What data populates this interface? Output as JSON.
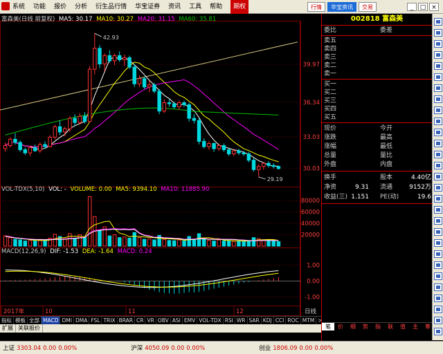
{
  "menu": {
    "items": [
      "系统",
      "功能",
      "报价",
      "分析",
      "衍生品行情",
      "华宝证券",
      "资讯",
      "工具",
      "帮助",
      "期权"
    ],
    "active_index": 9
  },
  "top_tabs": {
    "items": [
      "行情",
      "华宝资讯",
      "交易"
    ],
    "active_index": 1
  },
  "window_buttons": [
    "_",
    "□",
    "×"
  ],
  "chart": {
    "header_title": "富森美(日线 前复权)",
    "ma5": "MA5: 30.17",
    "ma10": "MA10: 30.27",
    "ma20": "MA20: 31.15",
    "ma60": "MA60: 35.81",
    "high_label": "42.93",
    "low_label": "29.19",
    "price_ticks": [
      "39.97",
      "36.34",
      "33.03",
      "30.03"
    ],
    "vol_header": {
      "title": "VOL-TDX(5,10)",
      "vol": "VOL: -",
      "volume": "VOLUME: 0.00",
      "ma5": "MA5: 9394.10",
      "ma10": "MA10: 11885.90"
    },
    "vol_ticks": [
      "80000",
      "60000",
      "40000",
      "20000"
    ],
    "macd_header": {
      "title": "MACD(12,26,9)",
      "dif": "DIF: -1.53",
      "dea": "DEA: -1.64",
      "macd": "MACD: 0.24"
    },
    "macd_ticks": [
      "1.00",
      "0.00",
      "-1.00"
    ],
    "date_labels": [
      "2017年",
      "10",
      "11",
      "12"
    ],
    "period_label": "日线",
    "colors": {
      "up": "#ff3232",
      "down": "#00d8e0",
      "ma5": "#ffffff",
      "ma10": "#ffff00",
      "ma20": "#ff00ff",
      "ma60": "#00c000",
      "grid": "#7a0000"
    }
  },
  "indicator_tabs": {
    "items": [
      "指标",
      "模板",
      "全部",
      "MACD",
      "DMI",
      "DMA",
      "FSL",
      "TRIX",
      "BRAR",
      "CR",
      "VR",
      "OBV",
      "ASI",
      "EMV",
      "VOL-TDX",
      "RSI",
      "WR",
      "SAR",
      "KDJ",
      "CCI",
      "ROC",
      "MTM",
      ">",
      "+",
      "-"
    ],
    "active_index": 3
  },
  "sub_tabs": [
    "扩展",
    "关联报价"
  ],
  "quote": {
    "code_name": "002818 富森美",
    "weibi_label": "委比",
    "weicha_label": "委差",
    "sell_levels": [
      "卖五",
      "卖四",
      "卖三",
      "卖二",
      "卖一"
    ],
    "buy_levels": [
      "买一",
      "买二",
      "买三",
      "买四",
      "买五"
    ],
    "stats_left": [
      "现价",
      "涨跌",
      "涨幅",
      "总量",
      "外盘"
    ],
    "stats_right": [
      "今开",
      "最高",
      "最低",
      "量比",
      "内盘"
    ],
    "extra": [
      {
        "label": "换手",
        "value": "",
        "label2": "股本",
        "value2": "4.40亿"
      },
      {
        "label": "净资",
        "value": "9.31",
        "label2": "流通",
        "value2": "9152万"
      },
      {
        "label": "收益(三)",
        "value": "1.151",
        "label2": "PE(动)",
        "value2": "19.6"
      }
    ],
    "bottom_tabs": [
      "笔",
      "价",
      "细",
      "势",
      "指",
      "联",
      "值",
      "主",
      "筹"
    ],
    "bottom_active": 0
  },
  "status": [
    {
      "name": "上证",
      "value": "3303.04",
      "change": "0.00",
      "pct": "0.00%"
    },
    {
      "name": "沪深",
      "value": "4050.09",
      "change": "0.00",
      "pct": "0.00%"
    },
    {
      "name": "创业",
      "value": "1806.09",
      "change": "0.00",
      "pct": "0.00%"
    }
  ],
  "candles": [
    [
      31.9,
      32.5,
      31.6,
      32.2
    ],
    [
      32.2,
      33.0,
      32.0,
      32.8
    ],
    [
      32.8,
      33.4,
      32.3,
      32.5
    ],
    [
      32.5,
      32.7,
      31.6,
      31.8
    ],
    [
      31.8,
      32.0,
      31.3,
      31.5
    ],
    [
      31.5,
      32.2,
      31.2,
      32.0
    ],
    [
      32.0,
      32.3,
      31.6,
      31.7
    ],
    [
      31.7,
      32.5,
      31.5,
      32.3
    ],
    [
      32.3,
      32.6,
      31.9,
      32.1
    ],
    [
      32.1,
      33.2,
      32.0,
      33.0
    ],
    [
      33.0,
      34.2,
      32.8,
      34.0
    ],
    [
      34.0,
      34.6,
      33.2,
      33.5
    ],
    [
      33.5,
      34.0,
      33.1,
      33.8
    ],
    [
      33.8,
      35.0,
      33.5,
      34.8
    ],
    [
      34.8,
      35.2,
      34.1,
      34.4
    ],
    [
      34.4,
      35.3,
      34.2,
      35.0
    ],
    [
      35.0,
      35.4,
      34.3,
      34.5
    ],
    [
      34.5,
      39.8,
      34.4,
      39.5
    ],
    [
      39.5,
      42.93,
      39.0,
      41.5
    ],
    [
      41.5,
      41.8,
      39.6,
      40.0
    ],
    [
      40.0,
      41.0,
      39.3,
      40.8
    ],
    [
      40.8,
      41.3,
      40.1,
      40.3
    ],
    [
      40.3,
      41.0,
      39.9,
      40.8
    ],
    [
      40.8,
      41.2,
      40.2,
      40.4
    ],
    [
      40.4,
      40.9,
      39.8,
      40.6
    ],
    [
      40.6,
      40.8,
      39.5,
      39.7
    ],
    [
      39.7,
      40.0,
      37.8,
      38.1
    ],
    [
      38.1,
      38.9,
      37.8,
      38.6
    ],
    [
      38.6,
      38.8,
      37.6,
      37.8
    ],
    [
      37.8,
      38.4,
      37.3,
      38.0
    ],
    [
      38.0,
      38.2,
      37.2,
      37.4
    ],
    [
      37.4,
      37.6,
      35.2,
      35.5
    ],
    [
      35.5,
      36.6,
      35.3,
      36.3
    ],
    [
      36.3,
      36.6,
      35.9,
      36.2
    ],
    [
      36.2,
      36.4,
      35.7,
      35.9
    ],
    [
      35.9,
      36.5,
      35.6,
      36.3
    ],
    [
      36.3,
      36.5,
      35.9,
      36.1
    ],
    [
      36.1,
      36.3,
      34.5,
      34.8
    ],
    [
      34.8,
      35.2,
      34.3,
      34.6
    ],
    [
      34.6,
      34.8,
      32.3,
      32.6
    ],
    [
      32.6,
      32.9,
      31.9,
      32.1
    ],
    [
      32.1,
      32.6,
      31.8,
      32.4
    ],
    [
      32.4,
      32.5,
      31.6,
      31.9
    ],
    [
      31.9,
      32.4,
      31.7,
      32.2
    ],
    [
      32.2,
      32.4,
      31.6,
      31.8
    ],
    [
      31.8,
      31.9,
      31.2,
      31.4
    ],
    [
      31.4,
      31.8,
      31.2,
      31.7
    ],
    [
      31.7,
      31.9,
      31.3,
      31.5
    ],
    [
      31.5,
      31.7,
      31.2,
      31.4
    ],
    [
      31.4,
      31.6,
      30.6,
      30.8
    ],
    [
      30.8,
      31.0,
      29.7,
      29.9
    ],
    [
      29.9,
      30.4,
      29.19,
      30.2
    ],
    [
      30.2,
      30.6,
      29.9,
      30.5
    ],
    [
      30.5,
      30.7,
      30.1,
      30.3
    ],
    [
      30.3,
      30.5,
      30.0,
      30.2
    ],
    [
      30.2,
      30.3,
      29.9,
      30.0
    ]
  ],
  "volumes": [
    18000,
    15000,
    12000,
    11000,
    9000,
    10000,
    9000,
    11000,
    10000,
    14000,
    21000,
    17000,
    13000,
    22000,
    14000,
    20000,
    15000,
    87000,
    52000,
    28000,
    34000,
    18000,
    20000,
    15000,
    16000,
    14000,
    24000,
    15000,
    12000,
    13000,
    11000,
    19000,
    12000,
    10000,
    9500,
    11000,
    9000,
    17000,
    12000,
    22000,
    13000,
    10000,
    9000,
    11000,
    9000,
    10000,
    8500,
    9000,
    8000,
    10000,
    15000,
    13000,
    11000,
    9500,
    9000,
    8000
  ],
  "macd_hist": [
    0.05,
    0.06,
    0.07,
    0.08,
    0.09,
    0.1,
    0.12,
    0.13,
    0.16,
    0.2,
    0.24,
    0.28,
    0.3,
    0.3,
    0.28,
    0.26,
    0.24,
    0.18,
    0.12,
    0.08,
    0.05,
    0.03,
    0.0,
    -0.02,
    -0.1,
    -0.15,
    -0.25,
    -0.35,
    -0.45,
    -0.55,
    -0.6,
    -0.7,
    -0.75,
    -0.78,
    -0.8,
    -0.78,
    -0.75,
    -0.7,
    -0.72,
    -0.68,
    -0.62,
    -0.55,
    -0.48,
    -0.42,
    -0.35,
    -0.28,
    -0.22,
    -0.16,
    -0.1,
    -0.06,
    0.02,
    0.06,
    0.1,
    0.14,
    0.18,
    0.24
  ]
}
